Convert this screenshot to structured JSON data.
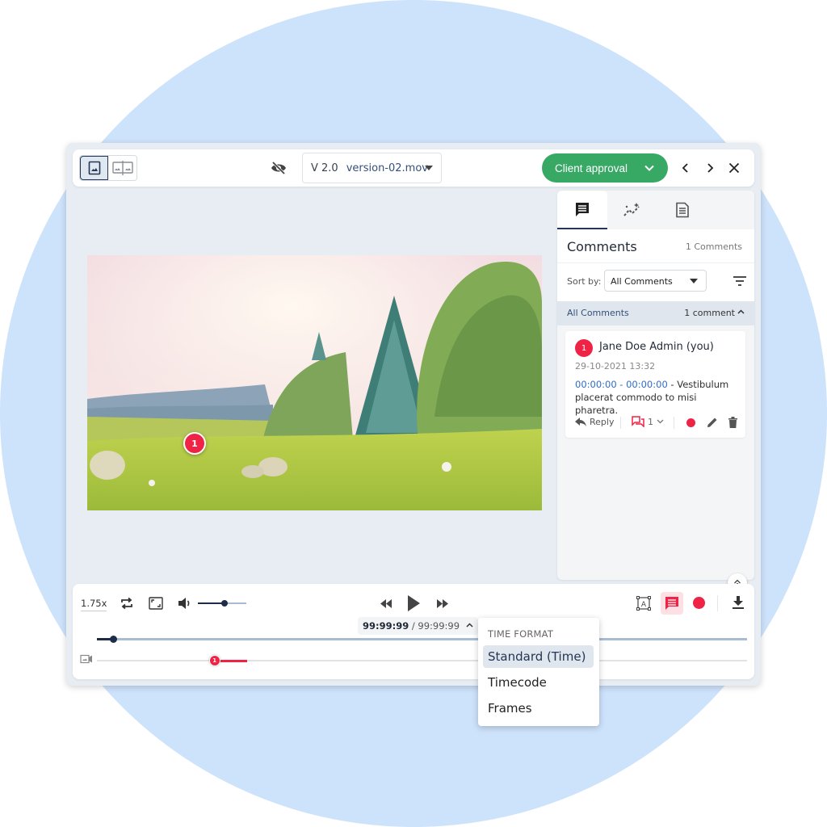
{
  "toolbar": {
    "view_modes": [
      "single-view",
      "compare-view"
    ],
    "active_view": "single-view",
    "version_number": "V 2.0",
    "version_file": "version-02.mov",
    "approval_label": "Client approval",
    "approval_color": "#38a865"
  },
  "video": {
    "annotation_marker": "1"
  },
  "panel": {
    "tabs": [
      "comments",
      "insights",
      "document"
    ],
    "active_tab": "comments",
    "title": "Comments",
    "count_label": "1 Comments",
    "sort_label": "Sort by:",
    "sort_value": "All Comments",
    "group_label": "All Comments",
    "group_count": "1 comment",
    "comments": [
      {
        "number": "1",
        "author": "Jane Doe Admin (you)",
        "date": "29-10-2021 13:32",
        "time_range": "00:00:00 - 00:00:00",
        "text": " - Vestibulum placerat commodo to misi pharetra.",
        "reply_label": "Reply",
        "thread_count": "1"
      }
    ]
  },
  "player": {
    "speed": "1.75x",
    "volume_fraction": 0.55,
    "current_time": "99:99:99",
    "separator": " / ",
    "total_time": "99:99:99",
    "progress_fraction": 0.025,
    "comment_marker": "1",
    "comment_range_start_fraction": 0.181,
    "comment_range_end_fraction": 0.231
  },
  "time_format_menu": {
    "header": "TIME FORMAT",
    "options": [
      "Standard (Time)",
      "Timecode",
      "Frames"
    ],
    "selected": "Standard (Time)"
  },
  "colors": {
    "accent_red": "#ee2346",
    "navy": "#1d2c48",
    "link_blue": "#2f6cc6"
  }
}
